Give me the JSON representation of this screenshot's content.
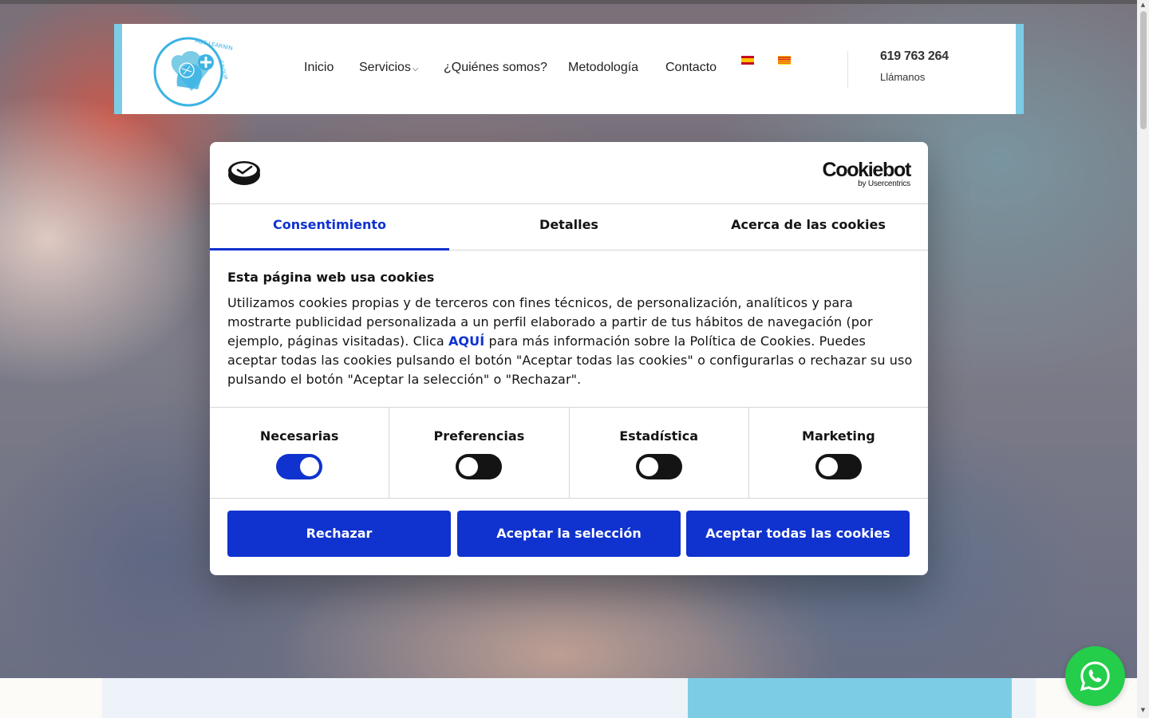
{
  "header": {
    "nav": [
      {
        "label": "Inicio"
      },
      {
        "label": "Servicios"
      },
      {
        "label": "¿Quiénes somos?"
      },
      {
        "label": "Metodología"
      },
      {
        "label": "Contacto"
      }
    ],
    "languages": [
      {
        "code": "es",
        "icon": "spain-flag-icon"
      },
      {
        "code": "ca",
        "icon": "catalonia-flag-icon"
      }
    ],
    "phone": "619 763 264",
    "phone_caption": "Llámanos",
    "logo_text": "A&C LEARNING GROUP",
    "colors": {
      "brand_blue": "#7dcce6"
    }
  },
  "cookie_dialog": {
    "brand_name": "Cookiebot",
    "brand_sub": "by Usercentrics",
    "tabs": [
      {
        "label": "Consentimiento",
        "active": true
      },
      {
        "label": "Detalles",
        "active": false
      },
      {
        "label": "Acerca de las cookies",
        "active": false
      }
    ],
    "title": "Esta página web usa cookies",
    "body_before_link": "Utilizamos cookies propias y de terceros con fines técnicos, de personalización, analíticos y para mostrarte publicidad personalizada a un perfil elaborado a partir de tus hábitos de navegación (por ejemplo, páginas visitadas). Clica ",
    "link_text": "AQUÍ",
    "body_after_link": " para más información sobre la Política de Cookies. Puedes aceptar todas las cookies pulsando el botón \"Aceptar todas las cookies\" o configurarlas o rechazar su uso pulsando el botón \"Aceptar la selección\" o \"Rechazar\".",
    "categories": [
      {
        "label": "Necesarias",
        "enabled": true
      },
      {
        "label": "Preferencias",
        "enabled": false
      },
      {
        "label": "Estadística",
        "enabled": false
      },
      {
        "label": "Marketing",
        "enabled": false
      }
    ],
    "buttons": {
      "reject": "Rechazar",
      "allow_selection": "Aceptar la selección",
      "allow_all": "Aceptar todas las cookies"
    },
    "colors": {
      "accent": "#1032cf",
      "text": "#141414"
    }
  },
  "whatsapp": {
    "icon": "whatsapp-icon",
    "color": "#24cd4a"
  }
}
